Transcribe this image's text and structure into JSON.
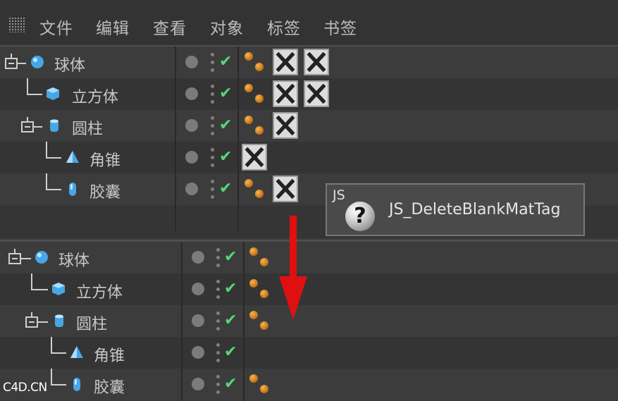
{
  "menu": {
    "items": [
      "文件",
      "编辑",
      "查看",
      "对象",
      "标签",
      "书签"
    ]
  },
  "panel_before": {
    "objects": [
      {
        "name": "球体",
        "icon": "sphere-icon",
        "material_tags": true,
        "empty_tags": 2
      },
      {
        "name": "立方体",
        "icon": "cube-icon",
        "material_tags": true,
        "empty_tags": 2
      },
      {
        "name": "圆柱",
        "icon": "cylinder-icon",
        "material_tags": true,
        "empty_tags": 1
      },
      {
        "name": "角锥",
        "icon": "cone-icon",
        "material_tags": false,
        "empty_tags": 1
      },
      {
        "name": "胶囊",
        "icon": "capsule-icon",
        "material_tags": true,
        "empty_tags": 1
      }
    ]
  },
  "panel_after": {
    "objects": [
      {
        "name": "球体",
        "icon": "sphere-icon",
        "material_tags": true
      },
      {
        "name": "立方体",
        "icon": "cube-icon",
        "material_tags": true
      },
      {
        "name": "圆柱",
        "icon": "cylinder-icon",
        "material_tags": true
      },
      {
        "name": "角锥",
        "icon": "cone-icon",
        "material_tags": false
      },
      {
        "name": "胶囊",
        "icon": "capsule-icon",
        "material_tags": true
      }
    ]
  },
  "tooltip": {
    "badge": "JS",
    "icon_glyph": "?",
    "label": "JS_DeleteBlankMatTag"
  },
  "check_glyph": "✔",
  "watermark": "C4D.CN",
  "colors": {
    "accent_check": "#55d67c",
    "arrow": "#e01010",
    "material": "#e08a20",
    "object_icon": "#46a6e6"
  }
}
